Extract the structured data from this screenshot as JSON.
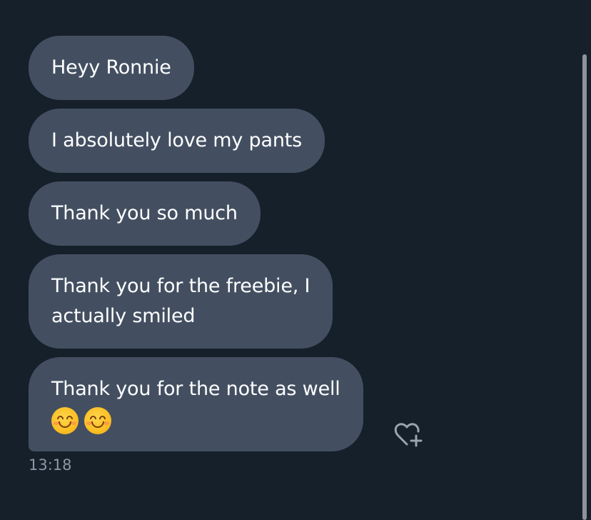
{
  "messages": [
    {
      "text": "Heyy Ronnie"
    },
    {
      "text": "I absolutely love my pants"
    },
    {
      "text": "Thank you so much"
    },
    {
      "lines": [
        "Thank you for the freebie, I",
        "actually smiled"
      ]
    },
    {
      "text": "Thank you for the note as well",
      "emojis": [
        "smiling-face-icon",
        "smiling-face-icon"
      ]
    }
  ],
  "timestamp": "13:18",
  "colors": {
    "background": "#16202b",
    "bubble": "#434f61",
    "text": "#ffffff",
    "timestamp": "#8b98a5",
    "scrollbar": "#8c939b"
  },
  "icons": {
    "react": "heart-plus-icon"
  }
}
